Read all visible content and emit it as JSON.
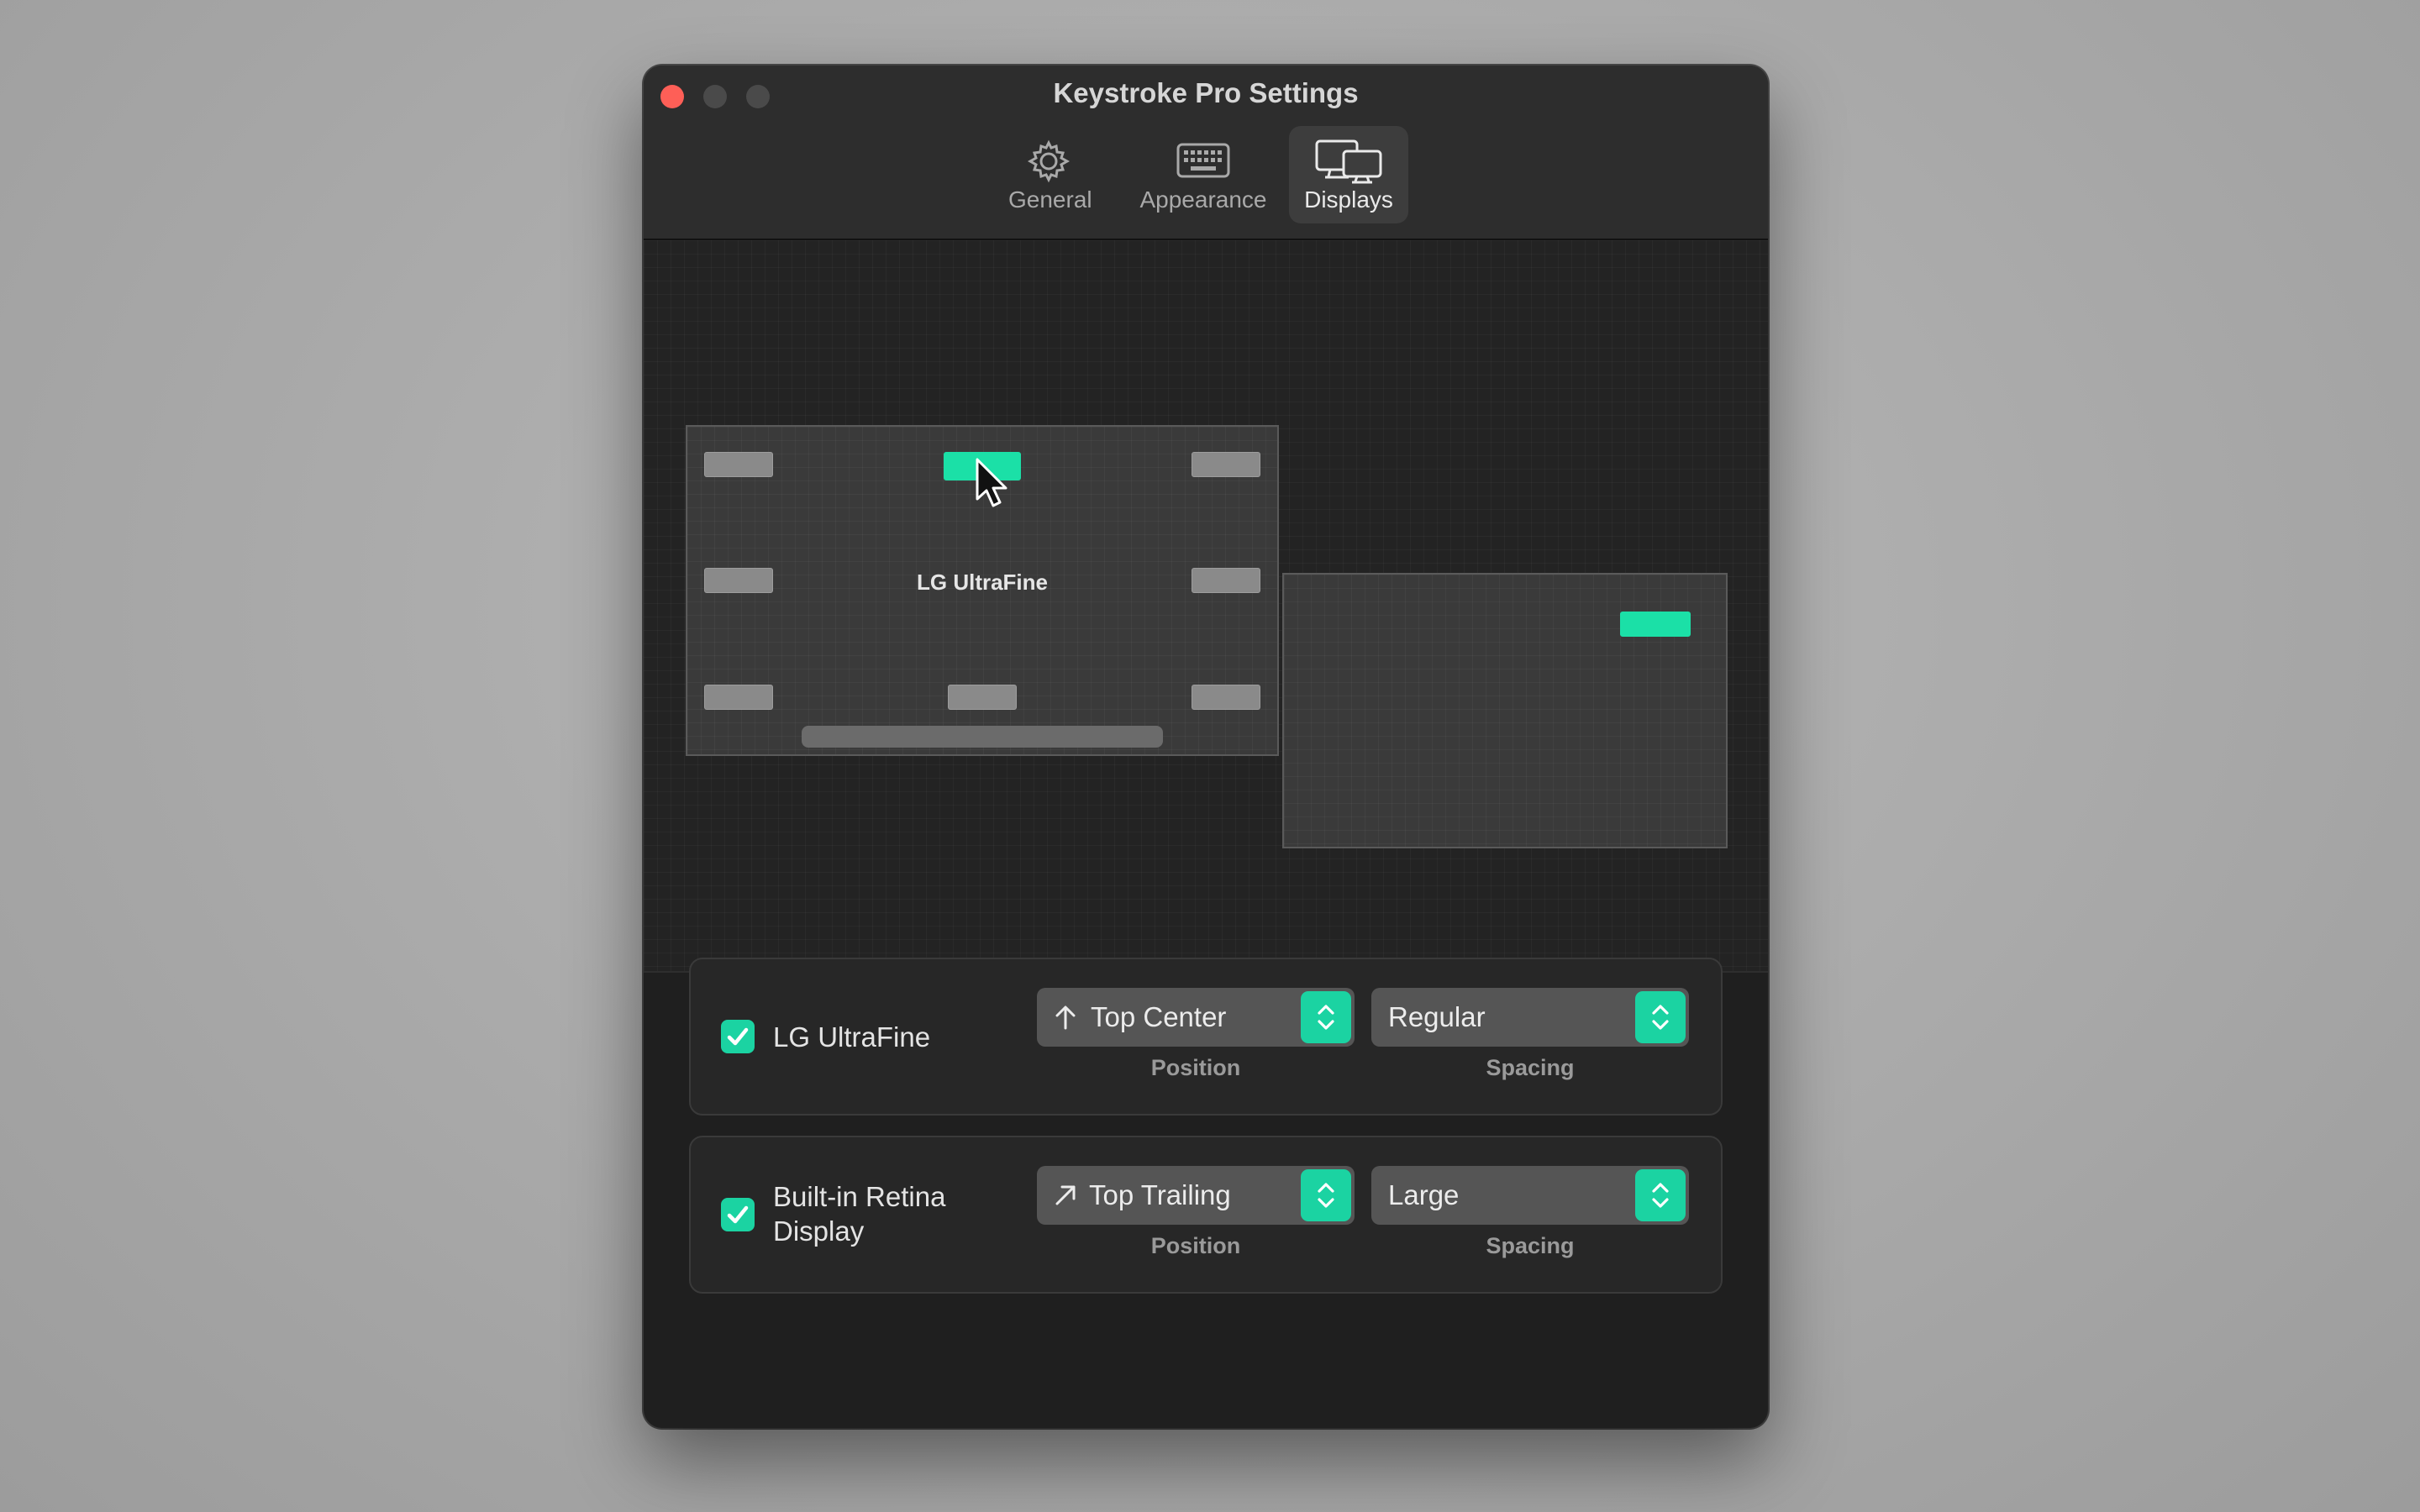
{
  "window": {
    "title": "Keystroke Pro Settings"
  },
  "toolbar": {
    "tabs": [
      {
        "label": "General",
        "icon": "gear-icon"
      },
      {
        "label": "Appearance",
        "icon": "keyboard-icon"
      },
      {
        "label": "Displays",
        "icon": "displays-icon",
        "selected": true
      }
    ]
  },
  "preview": {
    "main_display_label": "LG UltraFine",
    "active_slot_color": "#1be0a7"
  },
  "displays": [
    {
      "name": "LG UltraFine",
      "enabled": true,
      "position": {
        "value": "Top Center",
        "icon": "arrow-up-icon",
        "caption": "Position"
      },
      "spacing": {
        "value": "Regular",
        "caption": "Spacing"
      }
    },
    {
      "name": "Built-in Retina Display",
      "enabled": true,
      "position": {
        "value": "Top Trailing",
        "icon": "arrow-up-right-icon",
        "caption": "Position"
      },
      "spacing": {
        "value": "Large",
        "caption": "Spacing"
      }
    }
  ],
  "colors": {
    "accent": "#1bd3a2",
    "close": "#fe5f57",
    "window_bg": "#1f1f1f"
  }
}
